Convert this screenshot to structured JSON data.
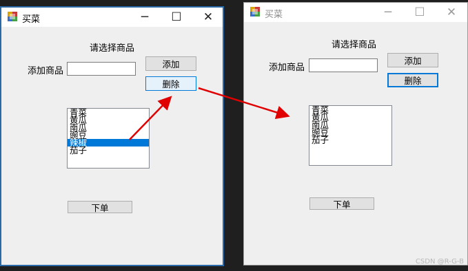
{
  "left_window": {
    "title": "买菜",
    "controls": {
      "minimize": "─",
      "maximize": "☐",
      "close": "✕"
    },
    "heading": "请选择商品",
    "add_item_label": "添加商品",
    "add_item_value": "",
    "add_button": "添加",
    "delete_button": "删除",
    "list_items": [
      "青菜",
      "黄瓜",
      "南瓜",
      "豌豆",
      "辣椒",
      "茄子"
    ],
    "selected_item": "辣椒",
    "order_button": "下单"
  },
  "right_window": {
    "title": "买菜",
    "controls": {
      "minimize": "─",
      "maximize": "☐",
      "close": "✕"
    },
    "heading": "请选择商品",
    "add_item_label": "添加商品",
    "add_item_value": "",
    "add_button": "添加",
    "delete_button": "删除",
    "list_items": [
      "青菜",
      "黄瓜",
      "南瓜",
      "豌豆",
      "茄子"
    ],
    "order_button": "下单"
  },
  "annotation_color": "#e00000",
  "watermark": "CSDN @R-G-B"
}
